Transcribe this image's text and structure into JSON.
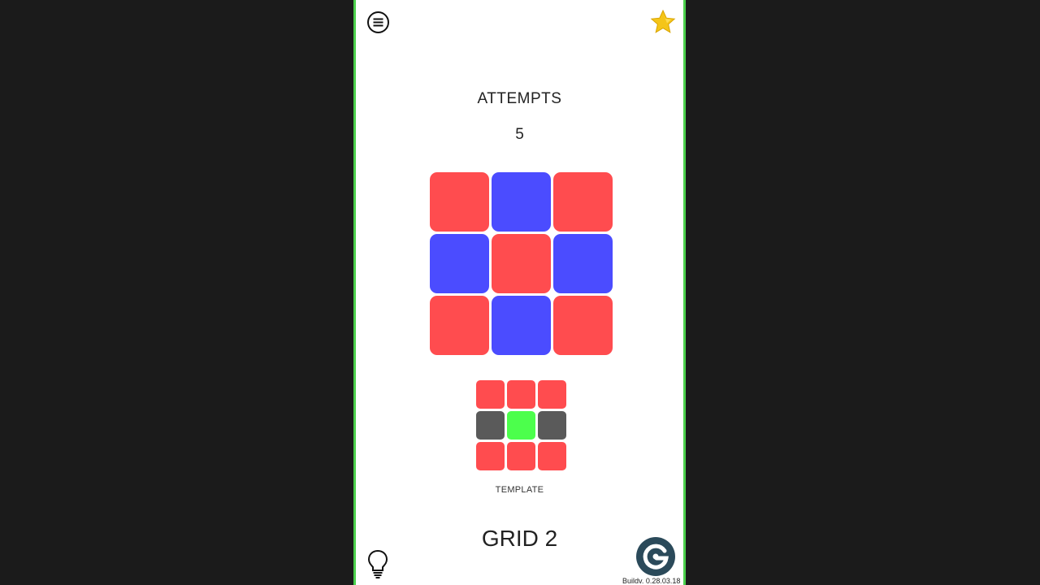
{
  "header": {
    "menu_icon": "hamburger-menu-icon",
    "star_icon": "star-icon"
  },
  "attempts": {
    "label": "ATTEMPTS",
    "value": "5"
  },
  "colors": {
    "red": "#ff4c4f",
    "blue": "#4b4cff",
    "gray": "#5a5a5a",
    "green": "#4cff4c",
    "frame": "#4cd04c",
    "logo": "#2b4a5a"
  },
  "main_grid": [
    [
      "red",
      "blue",
      "red"
    ],
    [
      "blue",
      "red",
      "blue"
    ],
    [
      "red",
      "blue",
      "red"
    ]
  ],
  "template": {
    "label": "TEMPLATE",
    "cells": [
      [
        "red",
        "red",
        "red"
      ],
      [
        "gray",
        "green",
        "gray"
      ],
      [
        "red",
        "red",
        "red"
      ]
    ]
  },
  "footer": {
    "title": "GRID 2",
    "hint_icon": "lightbulb-icon",
    "logo_icon": "restart-logo-icon",
    "build": "Buildv. 0.28.03.18"
  }
}
